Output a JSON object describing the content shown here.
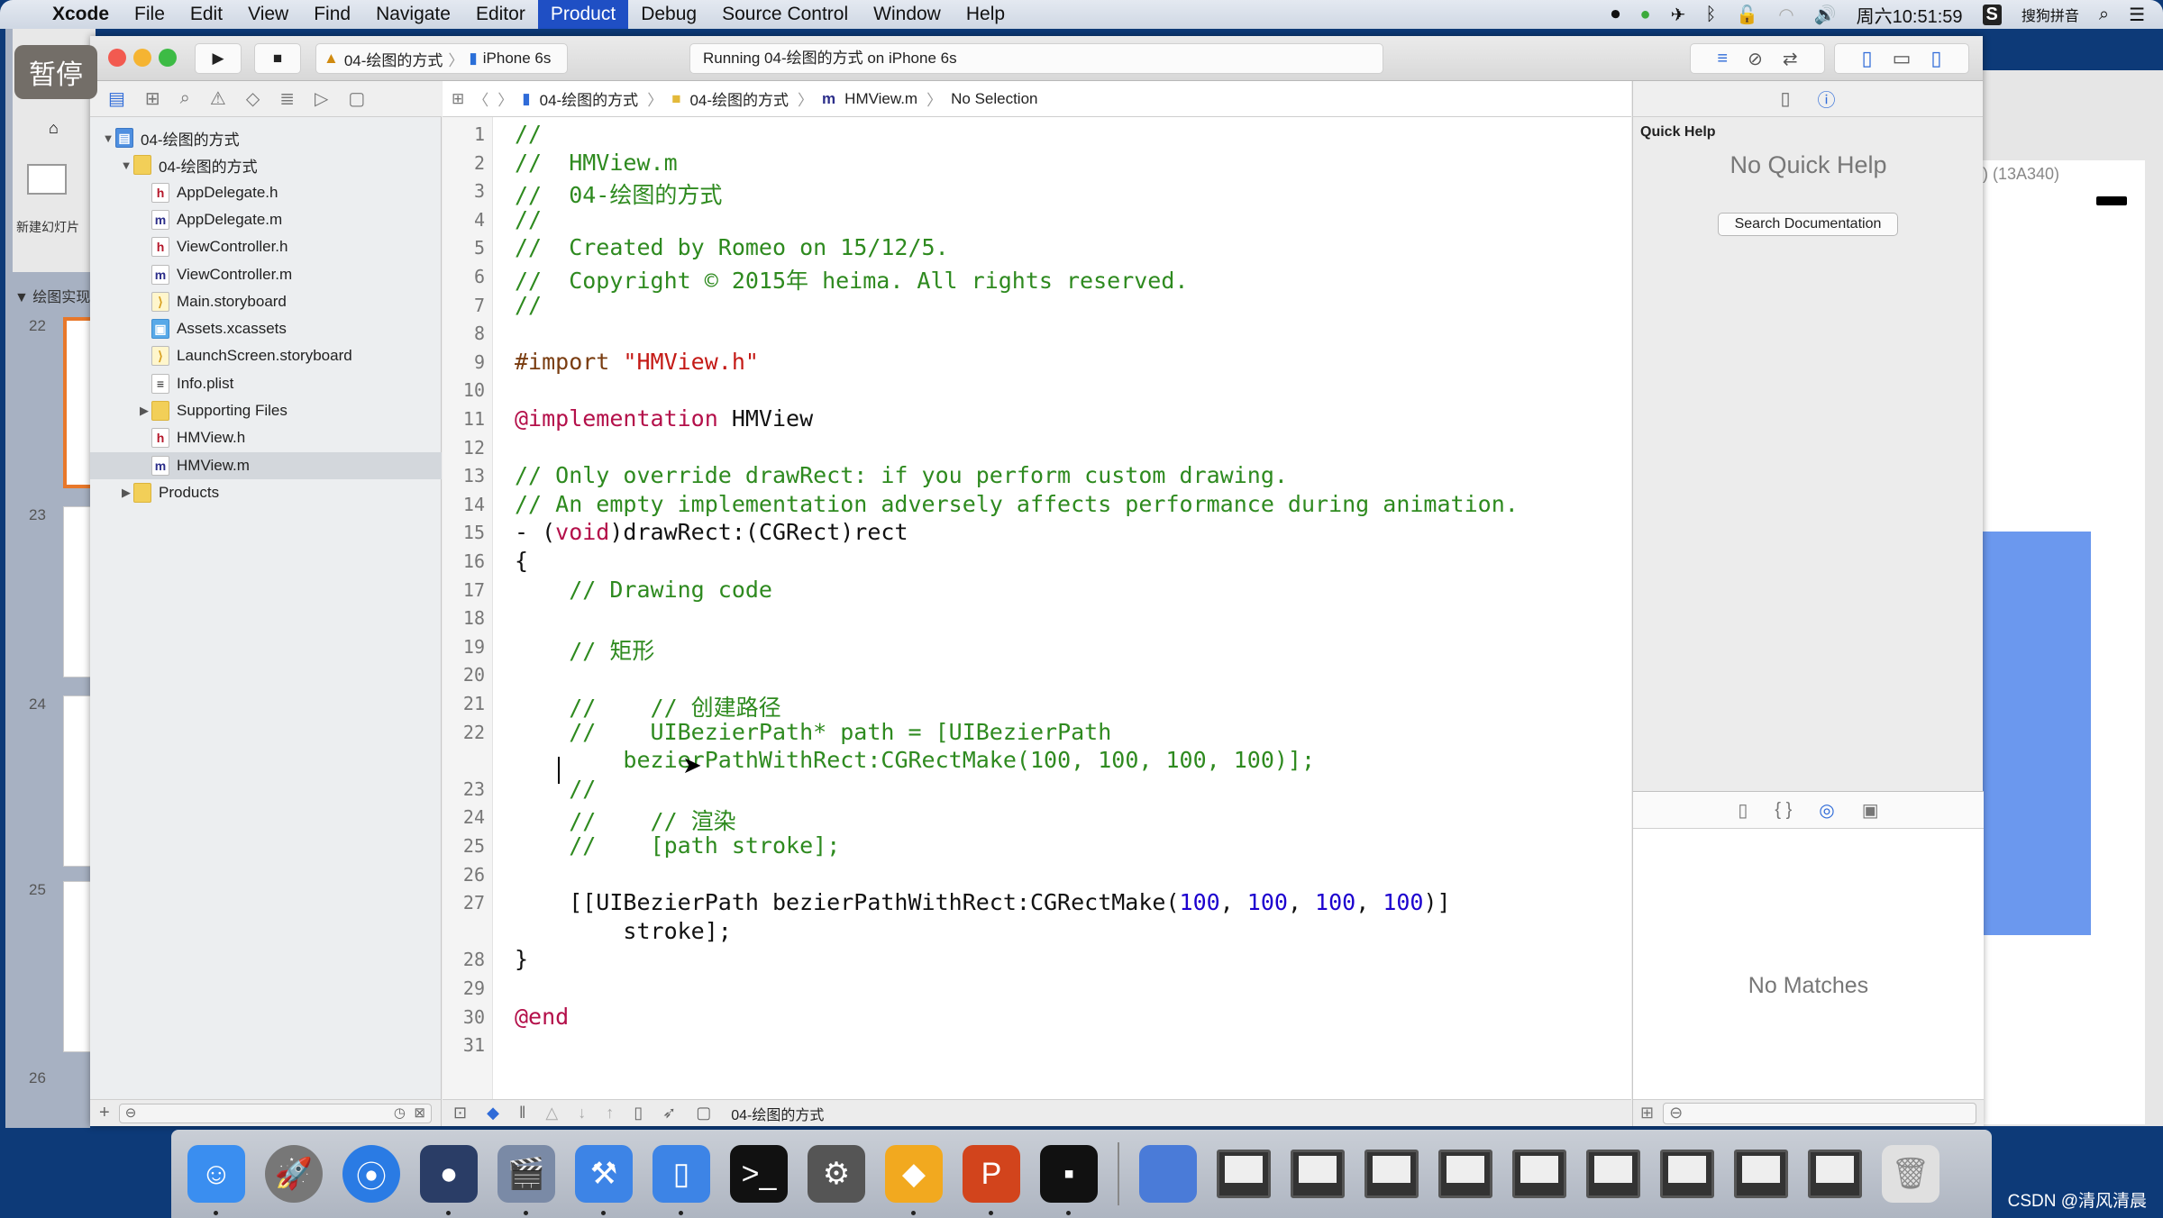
{
  "menubar": {
    "apple": "",
    "items": [
      "Xcode",
      "File",
      "Edit",
      "View",
      "Find",
      "Navigate",
      "Editor",
      "Product",
      "Debug",
      "Source Control",
      "Window",
      "Help"
    ],
    "active_item": "Product",
    "status": {
      "clock": "周六10:51:59",
      "input_method": "搜狗拼音"
    }
  },
  "overlay": {
    "pause_badge": "暂停"
  },
  "background_app": {
    "ppt_new_slide": "新建幻灯片",
    "ppt_section": "▼ 绘图实现",
    "slide_numbers": [
      "22",
      "23",
      "24",
      "25",
      "26"
    ],
    "simulator_title": ") (13A340)"
  },
  "toolbar": {
    "scheme": "04-绘图的方式",
    "device": "iPhone 6s",
    "activity": "Running 04-绘图的方式 on iPhone 6s"
  },
  "jumpbar": {
    "crumbs": [
      "04-绘图的方式",
      "04-绘图的方式",
      "HMView.m",
      "No Selection"
    ]
  },
  "navigator": {
    "items": [
      {
        "label": "04-绘图的方式",
        "type": "proj",
        "indent": 0,
        "disclosure": "▼"
      },
      {
        "label": "04-绘图的方式",
        "type": "folder",
        "indent": 1,
        "disclosure": "▼"
      },
      {
        "label": "AppDelegate.h",
        "type": "h",
        "indent": 2
      },
      {
        "label": "AppDelegate.m",
        "type": "m",
        "indent": 2
      },
      {
        "label": "ViewController.h",
        "type": "h",
        "indent": 2
      },
      {
        "label": "ViewController.m",
        "type": "m",
        "indent": 2
      },
      {
        "label": "Main.storyboard",
        "type": "sb",
        "indent": 2
      },
      {
        "label": "Assets.xcassets",
        "type": "assets",
        "indent": 2
      },
      {
        "label": "LaunchScreen.storyboard",
        "type": "sb",
        "indent": 2
      },
      {
        "label": "Info.plist",
        "type": "plist",
        "indent": 2
      },
      {
        "label": "Supporting Files",
        "type": "folder",
        "indent": 2,
        "disclosure": "▶"
      },
      {
        "label": "HMView.h",
        "type": "h",
        "indent": 2
      },
      {
        "label": "HMView.m",
        "type": "m",
        "indent": 2,
        "selected": true
      },
      {
        "label": "Products",
        "type": "folder",
        "indent": 1,
        "disclosure": "▶"
      }
    ]
  },
  "editor": {
    "file": "HMView.m",
    "lines": [
      {
        "n": "1",
        "html": "<span class='c'>//</span>"
      },
      {
        "n": "2",
        "html": "<span class='c'>//  HMView.m</span>"
      },
      {
        "n": "3",
        "html": "<span class='c'>//  04-绘图的方式</span>"
      },
      {
        "n": "4",
        "html": "<span class='c'>//</span>"
      },
      {
        "n": "5",
        "html": "<span class='c'>//  Created by Romeo on 15/12/5.</span>"
      },
      {
        "n": "6",
        "html": "<span class='c'>//  Copyright © 2015年 heima. All rights reserved.</span>"
      },
      {
        "n": "7",
        "html": "<span class='c'>//</span>"
      },
      {
        "n": "8",
        "html": ""
      },
      {
        "n": "9",
        "html": "<span class='p'>#import </span><span class='s'>\"HMView.h\"</span>"
      },
      {
        "n": "10",
        "html": ""
      },
      {
        "n": "11",
        "html": "<span class='k'>@implementation</span> HMView"
      },
      {
        "n": "12",
        "html": ""
      },
      {
        "n": "13",
        "html": "<span class='c'>// Only override drawRect: if you perform custom drawing.</span>"
      },
      {
        "n": "14",
        "html": "<span class='c'>// An empty implementation adversely affects performance during animation.</span>"
      },
      {
        "n": "15",
        "html": "- (<span class='k'>void</span>)drawRect:(CGRect)rect"
      },
      {
        "n": "16",
        "html": "{"
      },
      {
        "n": "17",
        "html": "    <span class='c'>// Drawing code</span>"
      },
      {
        "n": "18",
        "html": ""
      },
      {
        "n": "19",
        "html": "    <span class='c'>// 矩形</span>"
      },
      {
        "n": "20",
        "html": ""
      },
      {
        "n": "21",
        "html": "    <span class='c'>//    // 创建路径</span>"
      },
      {
        "n": "22",
        "html": "    <span class='c'>//    UIBezierPath* path = [UIBezierPath</span>"
      },
      {
        "n": "",
        "html": "        <span class='c'>bezierPathWithRect:CGRectMake(100, 100, 100, 100)];</span>"
      },
      {
        "n": "23",
        "html": "    <span class='c'>//</span>"
      },
      {
        "n": "24",
        "html": "    <span class='c'>//    // 渲染</span>"
      },
      {
        "n": "25",
        "html": "    <span class='c'>//    [path stroke];</span>"
      },
      {
        "n": "26",
        "html": ""
      },
      {
        "n": "27",
        "html": "    [[UIBezierPath bezierPathWithRect:CGRectMake(<span class='n'>100</span>, <span class='n'>100</span>, <span class='n'>100</span>, <span class='n'>100</span>)]"
      },
      {
        "n": "",
        "html": "        stroke];"
      },
      {
        "n": "28",
        "html": "}"
      },
      {
        "n": "29",
        "html": ""
      },
      {
        "n": "30",
        "html": "<span class='k'>@end</span>"
      },
      {
        "n": "31",
        "html": ""
      }
    ]
  },
  "debugbar": {
    "target": "04-绘图的方式"
  },
  "utilities": {
    "quick_help_title": "Quick Help",
    "no_quick_help": "No Quick Help",
    "search_docs_button": "Search Documentation",
    "no_matches": "No Matches"
  },
  "dock": {
    "apps": [
      {
        "name": "finder",
        "glyph": "☺",
        "bg": "#3a8ef0",
        "running": true
      },
      {
        "name": "launchpad",
        "glyph": "🚀",
        "bg": "#777",
        "running": false
      },
      {
        "name": "safari",
        "glyph": "⦿",
        "bg": "#2a7be4",
        "running": false
      },
      {
        "name": "mouse-app",
        "glyph": "●",
        "bg": "#2a3d66",
        "running": true
      },
      {
        "name": "video-app",
        "glyph": "🎬",
        "bg": "#7a8aa6",
        "running": true
      },
      {
        "name": "xcode",
        "glyph": "⚒",
        "bg": "#3d84e6",
        "running": true
      },
      {
        "name": "simulator",
        "glyph": "▯",
        "bg": "#3d84e6",
        "running": true
      },
      {
        "name": "terminal",
        "glyph": ">_",
        "bg": "#111",
        "running": false
      },
      {
        "name": "system-preferences",
        "glyph": "⚙",
        "bg": "#555",
        "running": false
      },
      {
        "name": "sketch",
        "glyph": "◆",
        "bg": "#f2a91f",
        "running": true
      },
      {
        "name": "powerpoint",
        "glyph": "P",
        "bg": "#d2441c",
        "running": true
      },
      {
        "name": "console",
        "glyph": "▪",
        "bg": "#111",
        "running": true
      }
    ],
    "minimized_windows": 9
  },
  "watermark": "CSDN @清风清晨"
}
